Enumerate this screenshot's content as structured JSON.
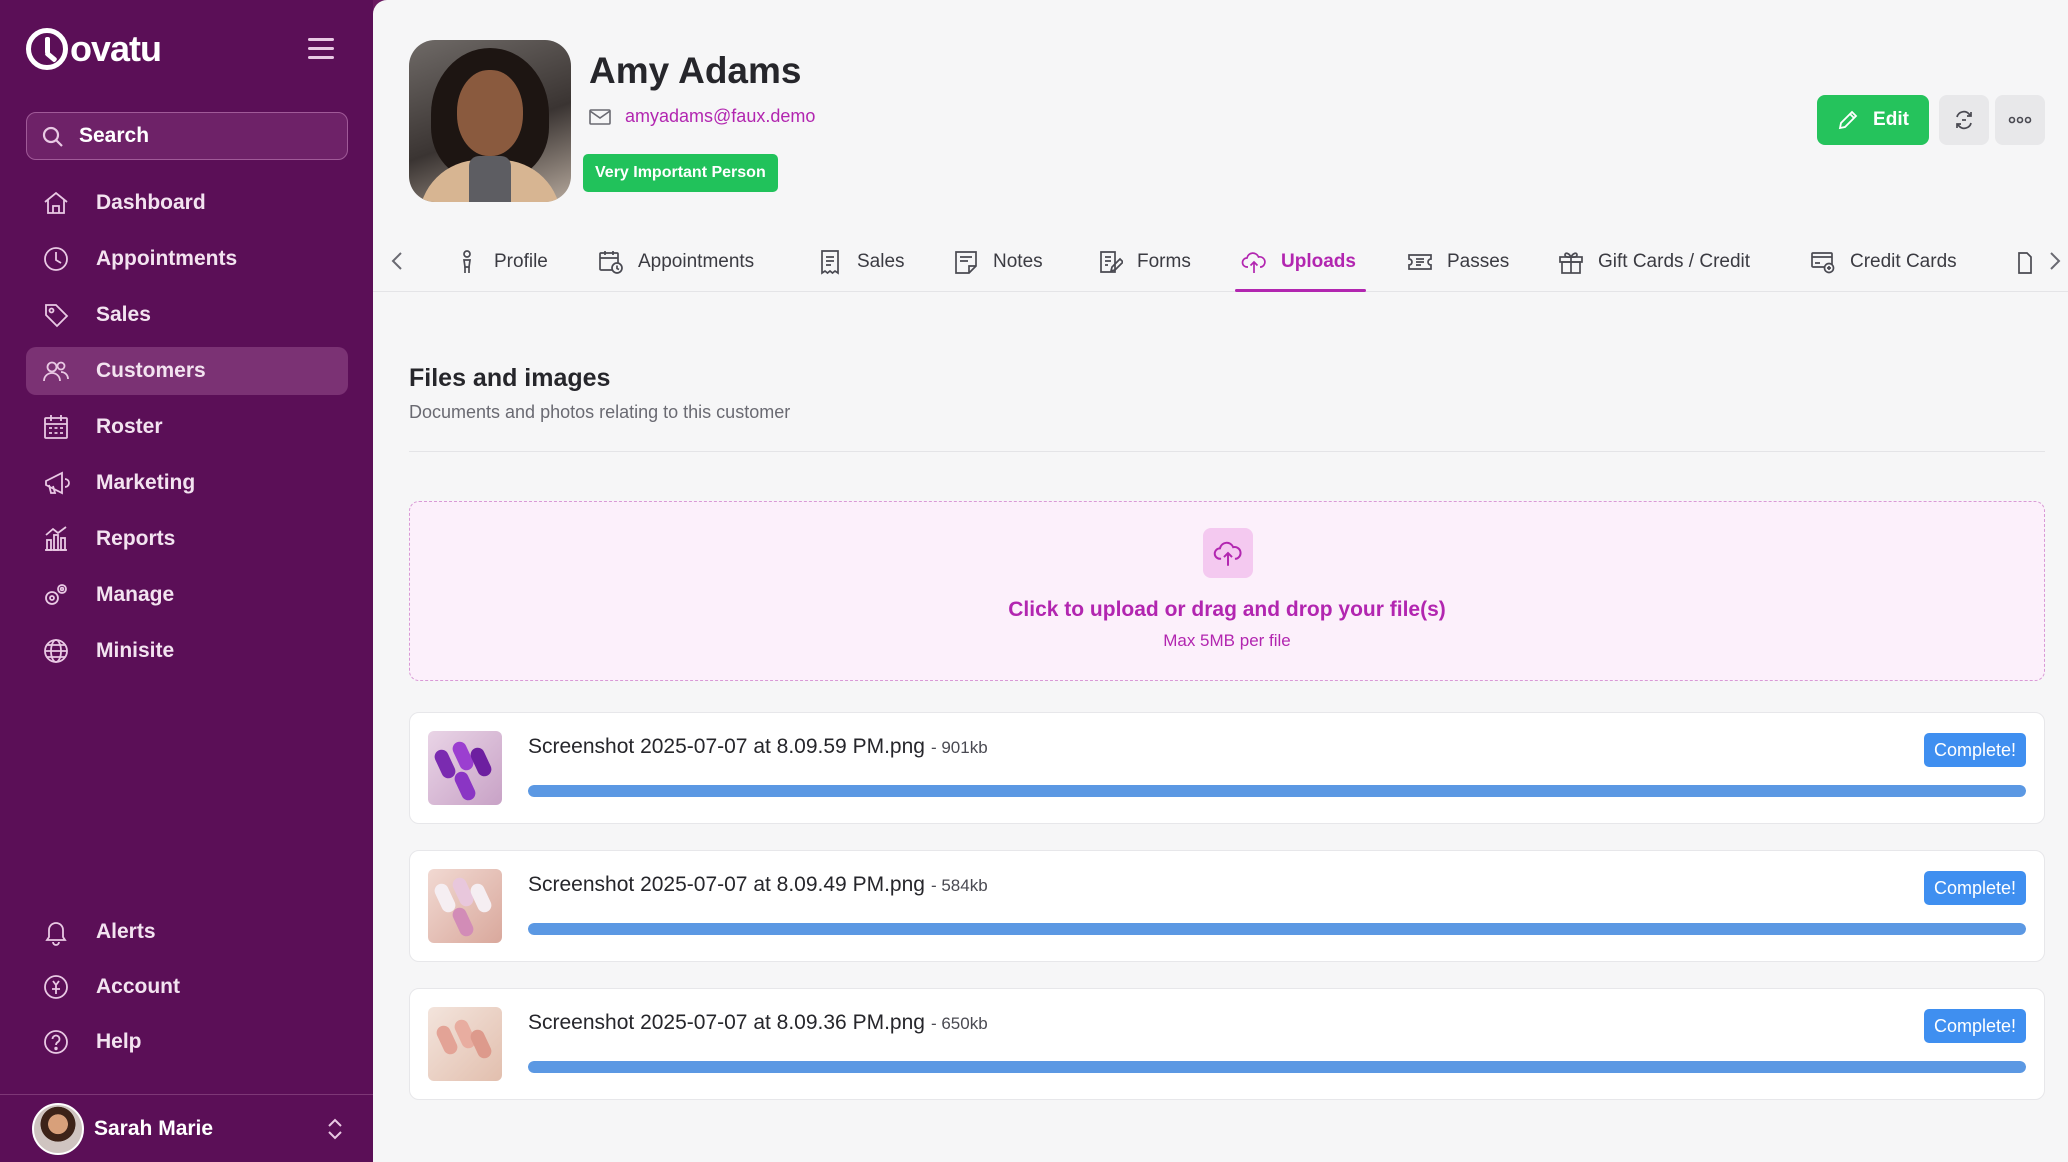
{
  "brand": {
    "name": "ovatu"
  },
  "search": {
    "label": "Search"
  },
  "nav": {
    "items": [
      {
        "label": "Dashboard",
        "icon": "home-icon"
      },
      {
        "label": "Appointments",
        "icon": "clock-icon"
      },
      {
        "label": "Sales",
        "icon": "tag-icon"
      },
      {
        "label": "Customers",
        "icon": "users-icon",
        "active": true
      },
      {
        "label": "Roster",
        "icon": "calendar-icon"
      },
      {
        "label": "Marketing",
        "icon": "megaphone-icon"
      },
      {
        "label": "Reports",
        "icon": "chart-icon"
      },
      {
        "label": "Manage",
        "icon": "gears-icon"
      },
      {
        "label": "Minisite",
        "icon": "globe-icon"
      }
    ],
    "bottom": [
      {
        "label": "Alerts",
        "icon": "bell-icon"
      },
      {
        "label": "Account",
        "icon": "account-icon"
      },
      {
        "label": "Help",
        "icon": "help-icon"
      }
    ]
  },
  "user": {
    "name": "Sarah Marie"
  },
  "customer": {
    "name": "Amy Adams",
    "email": "amyadams@faux.demo",
    "badge": "Very Important Person",
    "edit_label": "Edit"
  },
  "tabs": [
    {
      "label": "Profile",
      "icon": "person-icon"
    },
    {
      "label": "Appointments",
      "icon": "calendar-clock-icon"
    },
    {
      "label": "Sales",
      "icon": "receipt-icon"
    },
    {
      "label": "Notes",
      "icon": "note-icon"
    },
    {
      "label": "Forms",
      "icon": "form-icon"
    },
    {
      "label": "Uploads",
      "icon": "cloud-upload-icon",
      "active": true
    },
    {
      "label": "Passes",
      "icon": "ticket-icon"
    },
    {
      "label": "Gift Cards / Credit",
      "icon": "gift-icon"
    },
    {
      "label": "Credit Cards",
      "icon": "credit-card-icon"
    }
  ],
  "section": {
    "title": "Files and images",
    "subtitle": "Documents and photos relating to this customer"
  },
  "dropzone": {
    "title": "Click to upload or drag and drop your file(s)",
    "subtitle": "Max 5MB per file"
  },
  "files": [
    {
      "name": "Screenshot 2025-07-07 at 8.09.59 PM.png",
      "size": "- 901kb",
      "status": "Complete!",
      "progress": 100
    },
    {
      "name": "Screenshot 2025-07-07 at 8.09.49 PM.png",
      "size": "- 584kb",
      "status": "Complete!",
      "progress": 100
    },
    {
      "name": "Screenshot 2025-07-07 at 8.09.36 PM.png",
      "size": "- 650kb",
      "status": "Complete!",
      "progress": 100
    }
  ],
  "colors": {
    "sidebar": "#5b0f57",
    "accent": "#b226b0",
    "green": "#21c25b",
    "complete": "#3f8ff0"
  }
}
